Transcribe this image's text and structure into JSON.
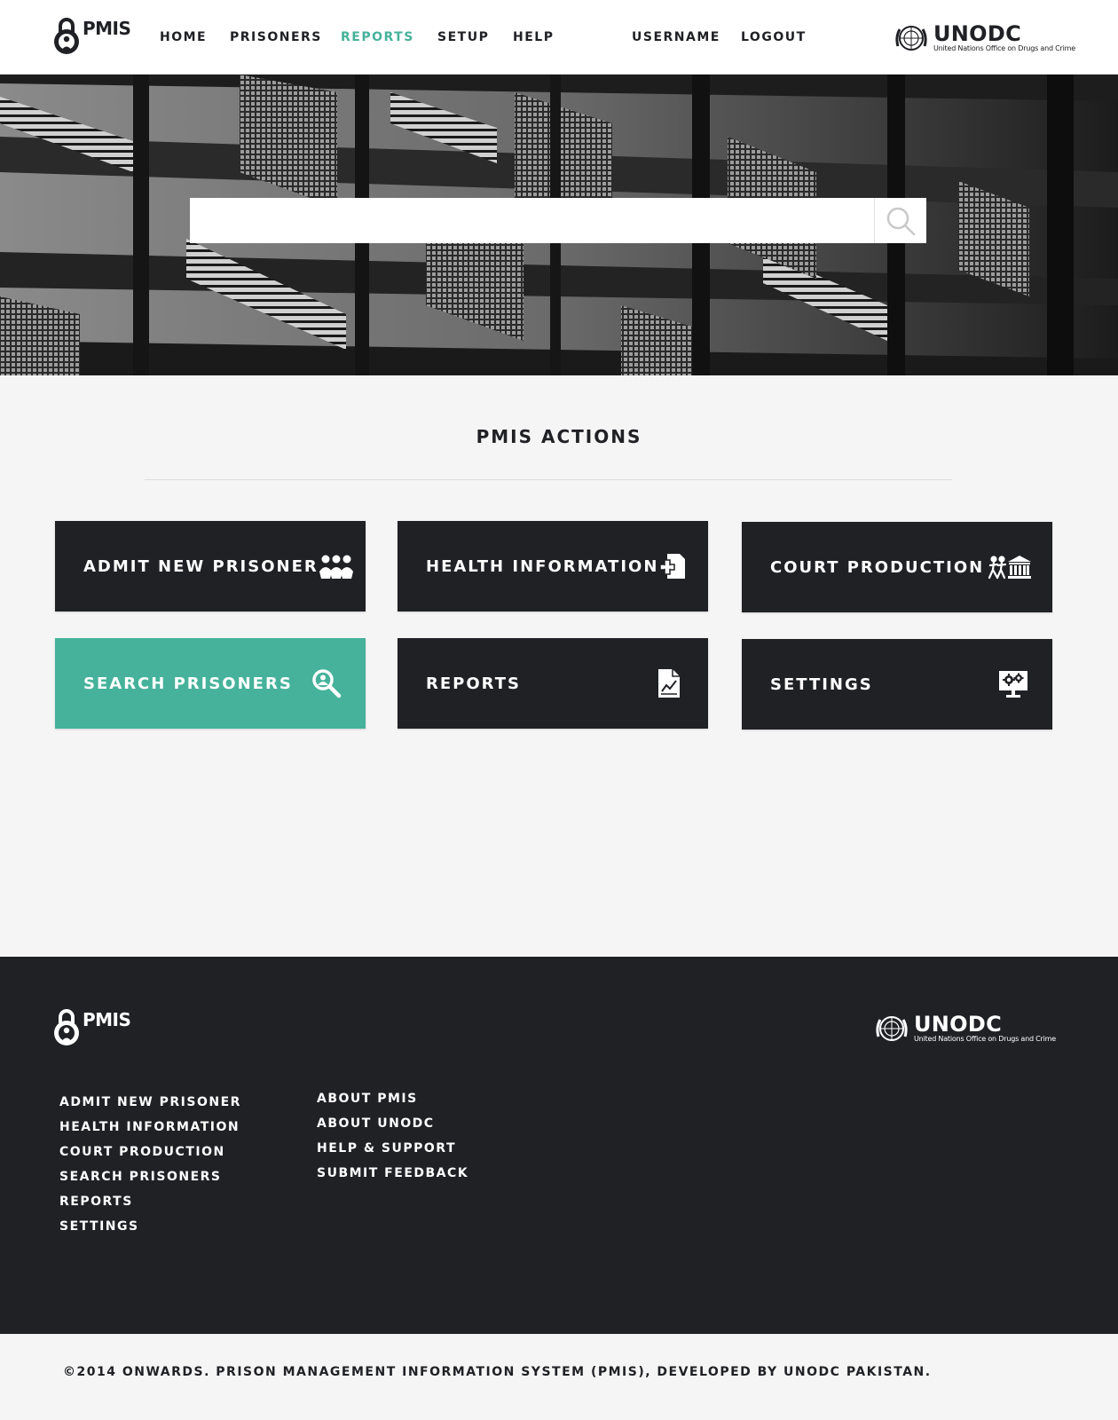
{
  "header": {
    "logo_text": "PMIS",
    "nav": [
      {
        "label": "HOME",
        "active": false
      },
      {
        "label": "PRISONERS",
        "active": false
      },
      {
        "label": "REPORTS",
        "active": true
      },
      {
        "label": "SETUP",
        "active": false
      },
      {
        "label": "HELP",
        "active": false
      }
    ],
    "username": "USERNAME",
    "logout": "LOGOUT",
    "partner_name": "UNODC",
    "partner_full": "United Nations Office on Drugs and Crime"
  },
  "hero": {
    "search": {
      "value": "",
      "placeholder": ""
    }
  },
  "actions": {
    "title": "PMIS ACTIONS",
    "tiles": [
      {
        "label": "ADMIT NEW PRISONER",
        "icon": "people-group-icon",
        "active": false
      },
      {
        "label": "HEALTH INFORMATION",
        "icon": "medical-file-icon",
        "active": false
      },
      {
        "label": "COURT PRODUCTION",
        "icon": "court-transfer-icon",
        "active": false
      },
      {
        "label": "SEARCH PRISONERS",
        "icon": "search-person-icon",
        "active": true
      },
      {
        "label": "REPORTS",
        "icon": "chart-document-icon",
        "active": false
      },
      {
        "label": "SETTINGS",
        "icon": "monitor-gears-icon",
        "active": false
      }
    ]
  },
  "footer": {
    "logo_text": "PMIS",
    "partner_name": "UNODC",
    "partner_full": "United Nations Office on Drugs and Crime",
    "col1": [
      "ADMIT NEW PRISONER",
      "HEALTH INFORMATION",
      "COURT PRODUCTION",
      "SEARCH PRISONERS",
      "REPORTS",
      "SETTINGS"
    ],
    "col2": [
      "ABOUT PMIS",
      "ABOUT UNODC",
      "HELP & SUPPORT",
      "SUBMIT FEEDBACK"
    ]
  },
  "copyright": "©2014 ONWARDS. PRISON MANAGEMENT INFORMATION SYSTEM (PMIS), DEVELOPED BY UNODC PAKISTAN.",
  "colors": {
    "accent": "#46b29b",
    "dark": "#202125",
    "background": "#f5f5f5"
  }
}
